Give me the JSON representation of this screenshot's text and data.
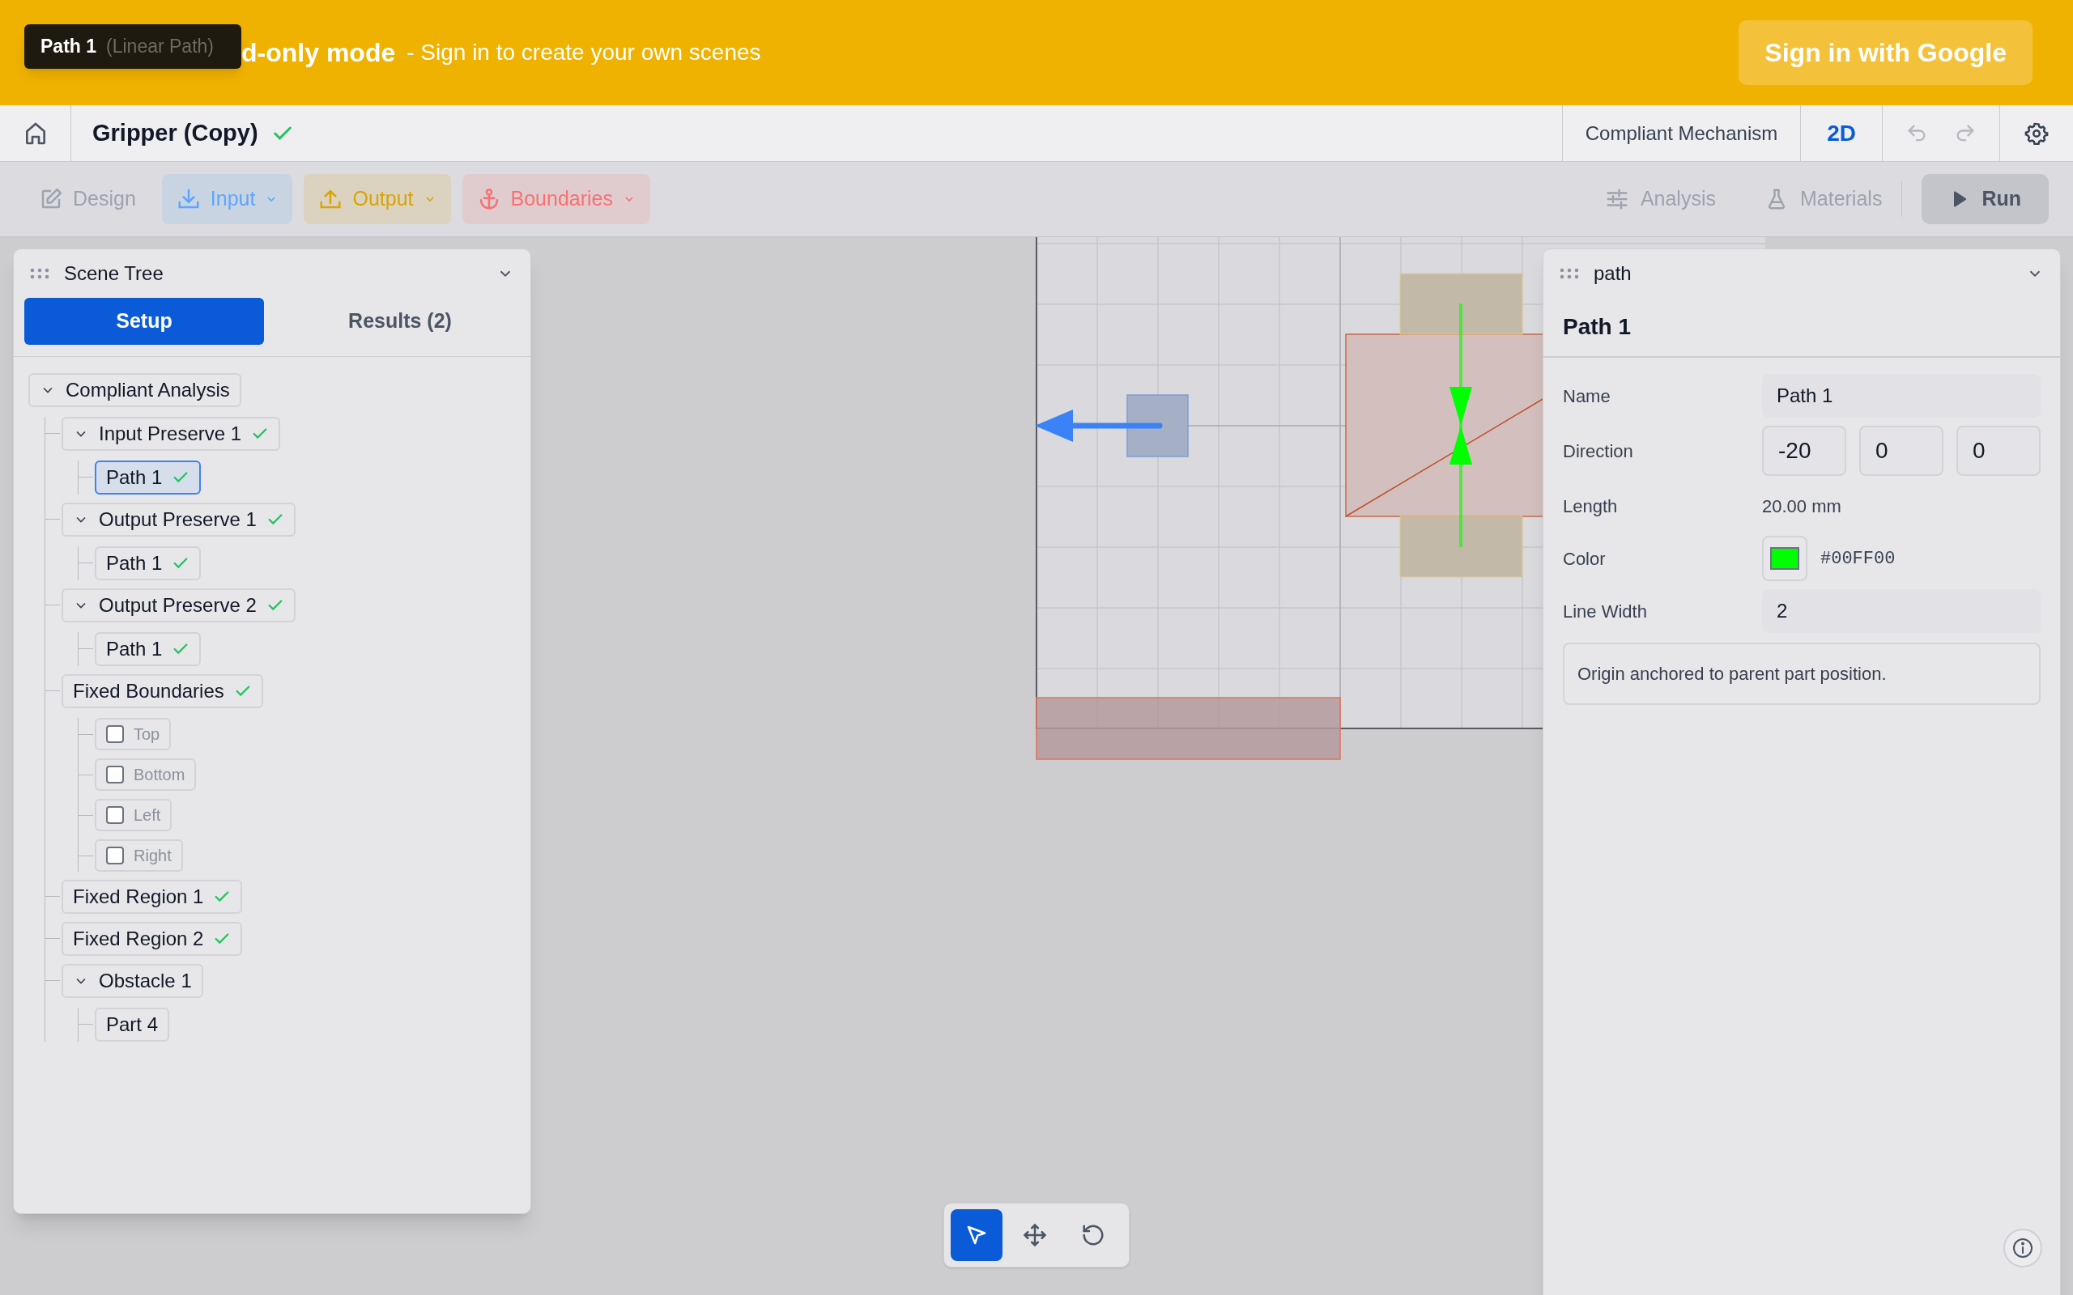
{
  "banner": {
    "message": "d-only mode",
    "hint": "- Sign in to create your own scenes",
    "button": "Sign in with Google"
  },
  "tooltip": {
    "title": "Path 1",
    "subtitle": "(Linear Path)"
  },
  "header": {
    "title": "Gripper (Copy)",
    "saved": true,
    "mode": "Compliant Mechanism",
    "view": "2D"
  },
  "toolbar": {
    "left": [
      {
        "label": "Design",
        "kind": "plain"
      },
      {
        "label": "Input",
        "kind": "menu",
        "color": "#60a5fa"
      },
      {
        "label": "Output",
        "kind": "menu",
        "color": "#d9a406"
      },
      {
        "label": "Boundaries",
        "kind": "menu",
        "color": "#f87171"
      }
    ],
    "right": [
      {
        "label": "Analysis"
      },
      {
        "label": "Materials"
      }
    ],
    "run": "Run"
  },
  "scene_tree": {
    "title": "Scene Tree",
    "tabs": [
      {
        "label": "Setup",
        "selected": true
      },
      {
        "label": "Results (2)",
        "selected": false
      }
    ],
    "items": [
      {
        "label": "Compliant Analysis",
        "kind": "node",
        "expanded": true,
        "valid": false,
        "selected": false,
        "children": [
          {
            "label": "Input Preserve 1",
            "kind": "node",
            "expanded": true,
            "valid": true,
            "selected": false,
            "children": [
              {
                "label": "Path 1",
                "kind": "node",
                "valid": true,
                "selected": true
              }
            ]
          },
          {
            "label": "Output Preserve 1",
            "kind": "node",
            "expanded": true,
            "valid": true,
            "selected": false,
            "children": [
              {
                "label": "Path 1",
                "kind": "node",
                "valid": true,
                "selected": false
              }
            ]
          },
          {
            "label": "Output Preserve 2",
            "kind": "node",
            "expanded": true,
            "valid": true,
            "selected": false,
            "children": [
              {
                "label": "Path 1",
                "kind": "node",
                "valid": true,
                "selected": false
              }
            ]
          },
          {
            "label": "Fixed Boundaries",
            "kind": "node",
            "valid": true,
            "selected": false,
            "children": [
              {
                "label": "Top",
                "kind": "checkbox",
                "checked": false
              },
              {
                "label": "Bottom",
                "kind": "checkbox",
                "checked": false
              },
              {
                "label": "Left",
                "kind": "checkbox",
                "checked": false
              },
              {
                "label": "Right",
                "kind": "checkbox",
                "checked": false
              }
            ]
          },
          {
            "label": "Fixed Region 1",
            "kind": "node",
            "valid": true,
            "selected": false
          },
          {
            "label": "Fixed Region 2",
            "kind": "node",
            "valid": true,
            "selected": false
          },
          {
            "label": "Obstacle 1",
            "kind": "node",
            "expanded": true,
            "valid": false,
            "selected": false,
            "children": [
              {
                "label": "Part 4",
                "kind": "node",
                "valid": false,
                "selected": false
              }
            ]
          }
        ]
      }
    ]
  },
  "properties": {
    "header": "path",
    "title": "Path 1",
    "fields": [
      {
        "label": "Name",
        "kind": "text",
        "value": "Path 1"
      },
      {
        "label": "Direction",
        "kind": "vector",
        "values": [
          "-20",
          "0",
          "0"
        ]
      },
      {
        "label": "Length",
        "kind": "readout",
        "value": "20.00 mm"
      },
      {
        "label": "Color",
        "kind": "color",
        "value": "#00FF00"
      },
      {
        "label": "Line Width",
        "kind": "text",
        "value": "2"
      }
    ],
    "note": "Origin anchored to parent part position."
  },
  "canvas_tools": [
    {
      "kind": "select",
      "selected": true
    },
    {
      "kind": "move",
      "selected": false
    },
    {
      "kind": "rotate",
      "selected": false
    }
  ]
}
